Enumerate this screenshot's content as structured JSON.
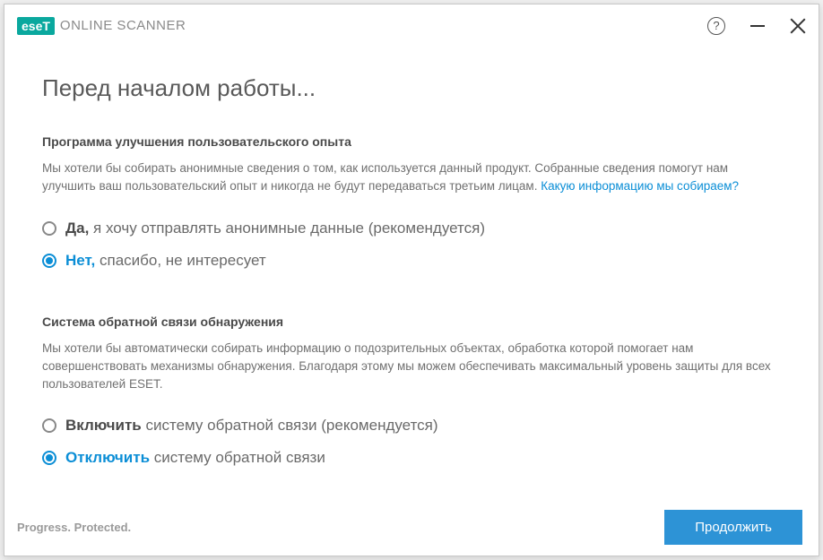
{
  "header": {
    "logo_badge": "eseT",
    "product_name": "ONLINE SCANNER"
  },
  "page_title": "Перед началом работы...",
  "section1": {
    "heading": "Программа улучшения пользовательского опыта",
    "desc_prefix": "Мы хотели бы собирать анонимные сведения о том, как используется данный продукт. Собранные сведения помогут нам улучшить ваш пользовательский опыт и никогда не будут передаваться третьим лицам. ",
    "link": "Какую информацию мы собираем?",
    "options": [
      {
        "bold": "Да,",
        "rest": " я хочу отправлять анонимные данные (рекомендуется)",
        "selected": false
      },
      {
        "bold": "Нет,",
        "rest": " спасибо, не интересует",
        "selected": true
      }
    ]
  },
  "section2": {
    "heading": "Система обратной связи обнаружения",
    "desc": "Мы хотели бы автоматически собирать информацию о подозрительных объектах, обработка которой помогает нам совершенствовать механизмы обнаружения. Благодаря этому мы можем обеспечивать максимальный уровень защиты для всех пользователей ESET.",
    "options": [
      {
        "bold": "Включить",
        "rest": " систему обратной связи (рекомендуется)",
        "selected": false
      },
      {
        "bold": "Отключить",
        "rest": " систему обратной связи",
        "selected": true
      }
    ]
  },
  "footer": {
    "tagline": "Progress. Protected.",
    "continue_label": "Продолжить"
  }
}
